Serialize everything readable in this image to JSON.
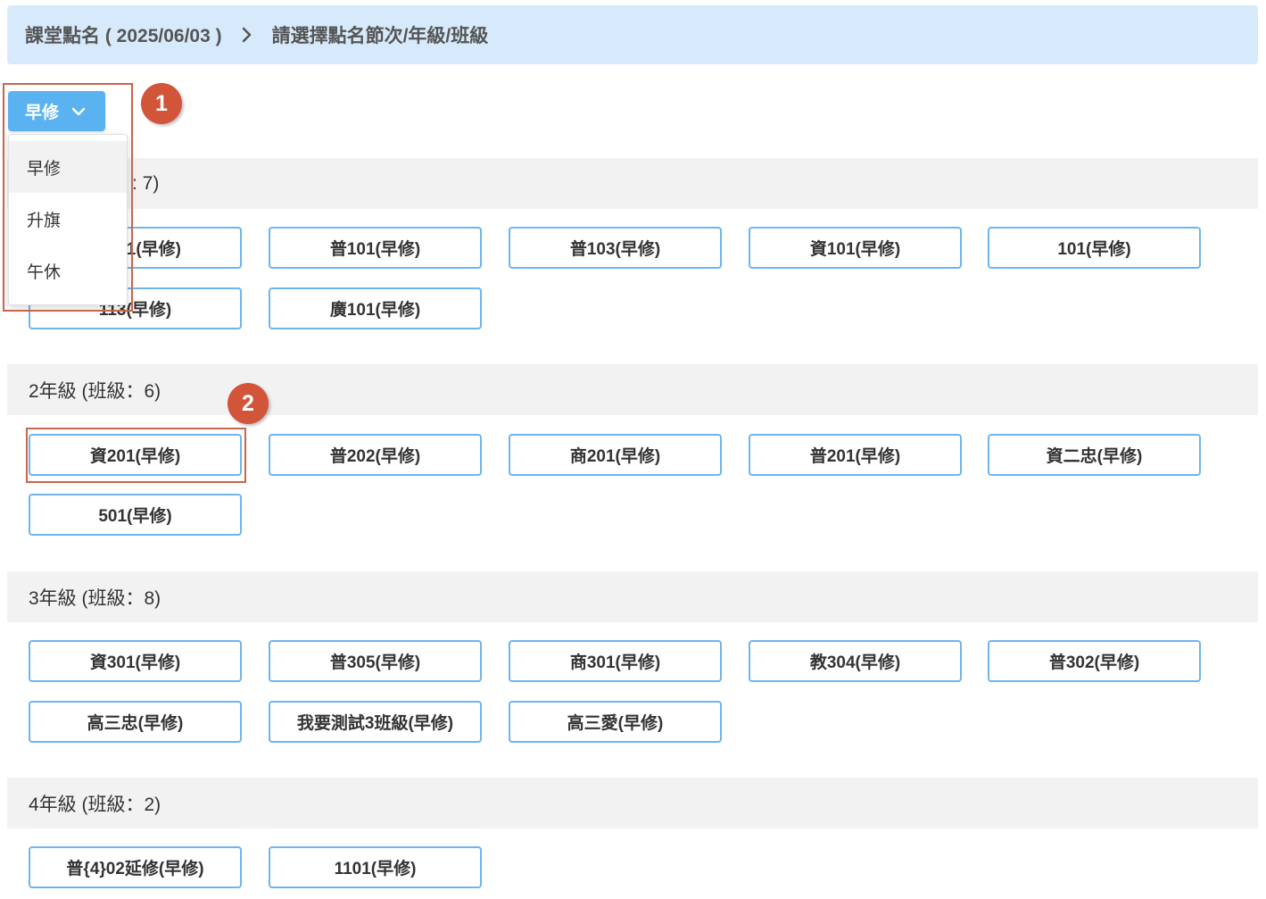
{
  "header": {
    "title": "課堂點名 ( 2025/06/03 )",
    "subtitle": "請選擇點名節次/年級/班級"
  },
  "period_select": {
    "selected": "早修",
    "options": [
      "早修",
      "升旗",
      "午休"
    ]
  },
  "annotations": {
    "badge1": "1",
    "badge2": "2"
  },
  "grades": [
    {
      "label_suffix": ": 7)",
      "classes": [
        "1(早修)",
        "普101(早修)",
        "普103(早修)",
        "資101(早修)",
        "101(早修)",
        "113(早修)",
        "廣101(早修)"
      ]
    },
    {
      "label": "2年級 (班級：6)",
      "classes": [
        "資201(早修)",
        "普202(早修)",
        "商201(早修)",
        "普201(早修)",
        "資二忠(早修)",
        "501(早修)"
      ]
    },
    {
      "label": "3年級 (班級：8)",
      "classes": [
        "資301(早修)",
        "普305(早修)",
        "商301(早修)",
        "教304(早修)",
        "普302(早修)",
        "高三忠(早修)",
        "我要測試3班級(早修)",
        "高三愛(早修)"
      ]
    },
    {
      "label": "4年級 (班級：2)",
      "classes": [
        "普{4}02延修(早修)",
        "1101(早修)"
      ]
    }
  ],
  "colors": {
    "header_bg": "#d7eafb",
    "accent": "#5ab3f0",
    "button_border": "#6fb4ee",
    "annotation": "#d2553a",
    "section_bg": "#f2f2f2"
  },
  "icons": {
    "breadcrumb_separator": "chevron-right-icon",
    "dropdown": "chevron-down-icon"
  }
}
